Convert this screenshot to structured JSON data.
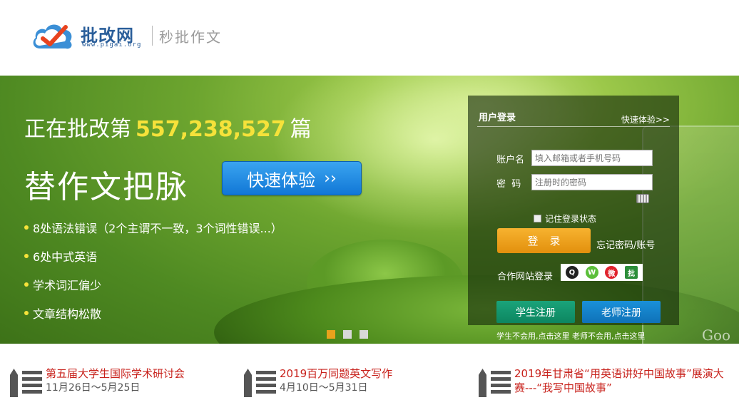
{
  "header": {
    "brand": "批改网",
    "brand_url": "www.pigai.org",
    "slogan": "秒批作文",
    "logo_icon": "cloud-check-icon"
  },
  "banner": {
    "counter_prefix": "正在批改第",
    "counter_value": "557,238,527",
    "counter_suffix": "篇",
    "headline": "替作文把脉",
    "try_button": "快速体验",
    "try_button_arrow": "››",
    "background_text": "Goo",
    "features": [
      "8处语法错误（2个主谓不一致，3个词性错误...）",
      "6处中式英语",
      "学术词汇偏少",
      "文章结构松散"
    ],
    "active_slide": 0,
    "slide_count": 3
  },
  "login": {
    "title": "用户登录",
    "quick_link": "快速体验>>",
    "account_label": "账户名",
    "account_placeholder": "填入邮箱或者手机号码",
    "password_label": "密  码",
    "password_placeholder": "注册时的密码",
    "remember_label": "记住登录状态",
    "login_button": "登录",
    "forgot_link": "忘记密码/账号",
    "partner_label": "合作网站登录",
    "partners": [
      "qq-icon",
      "wechat-icon",
      "weibo-icon",
      "pigai-icon"
    ],
    "student_register": "学生注册",
    "teacher_register": "老师注册",
    "register_hint": "学生不会用,点击这里  老师不会用,点击这里"
  },
  "news": [
    {
      "title": "第五届大学生国际学术研讨会",
      "date": "11月26日～5月25日"
    },
    {
      "title": "2019百万同题英文写作",
      "date": "4月10日～5月31日"
    },
    {
      "title": "2019年甘肃省“用英语讲好中国故事”展演大赛---“我写中国故事”",
      "date": ""
    }
  ],
  "colors": {
    "brand_blue": "#2a5e9a",
    "counter_yellow": "#f6e23a",
    "try_button_blue": "#1177d6",
    "login_orange": "#e2900d",
    "student_green": "#0d8660",
    "teacher_blue": "#0f72b8",
    "news_red": "#c8221c"
  }
}
